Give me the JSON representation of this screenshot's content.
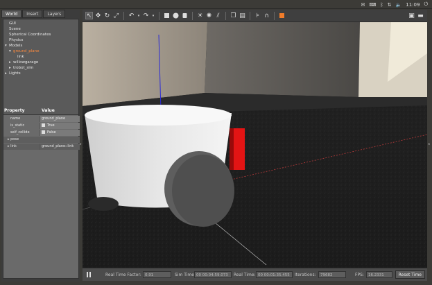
{
  "topbar": {
    "clock": "11:09",
    "tray_icons": [
      "mail-icon",
      "keyboard-icon",
      "bluetooth-icon",
      "network-icon",
      "volume-icon",
      "power-icon"
    ]
  },
  "left_panel": {
    "tabs": [
      "World",
      "Insert",
      "Layers"
    ],
    "tree": [
      {
        "label": "GUI",
        "indent": 0,
        "arrow": ""
      },
      {
        "label": "Scene",
        "indent": 0,
        "arrow": ""
      },
      {
        "label": "Spherical Coordinates",
        "indent": 0,
        "arrow": ""
      },
      {
        "label": "Physics",
        "indent": 0,
        "arrow": ""
      },
      {
        "label": "Models",
        "indent": 0,
        "arrow": "▼"
      },
      {
        "label": "ground_plane",
        "indent": 1,
        "arrow": "▼",
        "selected": true
      },
      {
        "label": "link",
        "indent": 2,
        "arrow": ""
      },
      {
        "label": "willowgarage",
        "indent": 1,
        "arrow": "▶"
      },
      {
        "label": "trobot_sim",
        "indent": 1,
        "arrow": "▶"
      },
      {
        "label": "Lights",
        "indent": 0,
        "arrow": "▶"
      }
    ],
    "properties": {
      "header_property": "Property",
      "header_value": "Value",
      "rows": [
        {
          "key": "name",
          "value": "ground_plane"
        },
        {
          "key": "is_static",
          "value": "True",
          "checkbox": true
        },
        {
          "key": "self_collide",
          "value": "False",
          "checkbox": true
        }
      ],
      "groups": [
        {
          "key": "pose",
          "value": ""
        },
        {
          "key": "link",
          "value": "ground_plane::link"
        }
      ]
    }
  },
  "toolbar": {
    "icons": [
      "select-arrow-icon",
      "translate-icon",
      "rotate-icon",
      "scale-icon",
      "undo-icon",
      "undo-dropdown-icon",
      "redo-icon",
      "redo-dropdown-icon",
      "box-icon",
      "sphere-icon",
      "cylinder-icon",
      "point-light-icon",
      "spot-light-icon",
      "directional-light-icon",
      "copy-icon",
      "paste-icon",
      "align-icon",
      "snap-icon",
      "orange-shape-icon",
      "screenshot-icon",
      "record-icon"
    ]
  },
  "statusbar": {
    "real_time_factor_label": "Real Time Factor:",
    "real_time_factor": "0.91",
    "sim_time_label": "Sim Time:",
    "sim_time": "00 00:04:59.073",
    "real_time_label": "Real Time:",
    "real_time": "00 00:01:35.455",
    "iterations_label": "Iterations:",
    "iterations": "79682",
    "fps_label": "FPS:",
    "fps": "16.2331",
    "reset_label": "Reset Time"
  }
}
